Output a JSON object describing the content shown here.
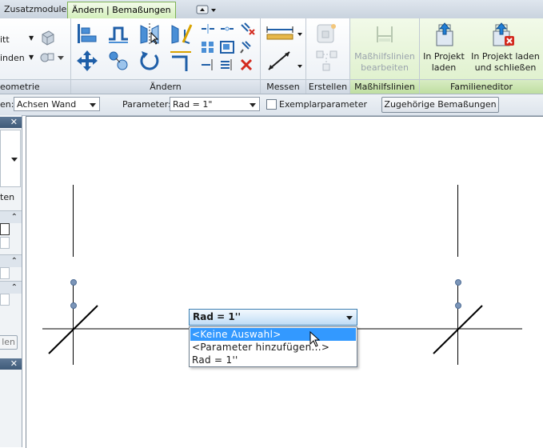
{
  "tabs": {
    "zusatzmodule": "Zusatzmodule",
    "aendern_bemassungen": "Ändern | Bemaßungen"
  },
  "ribbon": {
    "geometrie": {
      "title": "eometrie",
      "item1": "itt",
      "item2": "inden"
    },
    "aendern": {
      "title": "Ändern"
    },
    "messen": {
      "title": "Messen"
    },
    "erstellen": {
      "title": "Erstellen"
    },
    "masshilfslinien": {
      "title": "Maßhilfslinien",
      "button_line1": "Maßhilfslinien",
      "button_line2": "bearbeiten"
    },
    "familieneditor": {
      "title": "Familieneditor",
      "load_line1": "In Projekt",
      "load_line2": "laden",
      "load_close_line1": "In Projekt laden",
      "load_close_line2": "und schließen"
    }
  },
  "options_bar": {
    "bezug_label": "en:",
    "bezug_value": "Achsen Wand",
    "parameter_label": "Parameter:",
    "parameter_value": "Rad = 1\"",
    "exemplar_label": "Exemplarparameter",
    "exemplar_checked": false,
    "zugehoerige_button": "Zugehörige Bemaßungen"
  },
  "left_palette": {
    "close_glyph": "✕",
    "ten_text": "ten",
    "apply_button": "len"
  },
  "dimension_dropdown": {
    "selected_value": "Rad = 1''",
    "options": [
      "<Keine Auswahl>",
      "<Parameter hinzufügen...>",
      "Rad = 1''"
    ],
    "highlighted_index": 0
  },
  "colors": {
    "active_tab": "#d4efbb",
    "highlight": "#3399ff",
    "grip": "#7b95b8"
  }
}
